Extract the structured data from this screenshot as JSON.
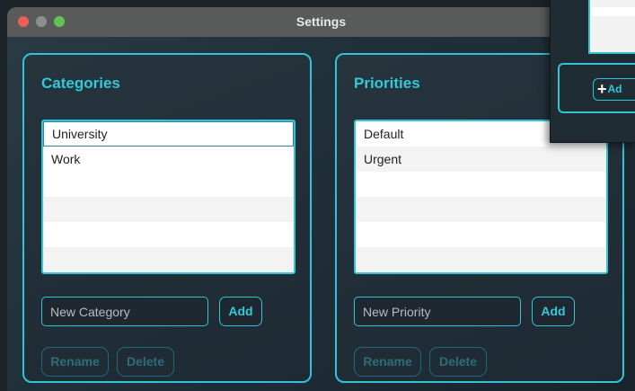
{
  "window": {
    "title": "Settings"
  },
  "categories": {
    "title": "Categories",
    "items": [
      "University",
      "Work"
    ],
    "input_placeholder": "New Category",
    "add_label": "Add",
    "rename_label": "Rename",
    "delete_label": "Delete"
  },
  "priorities": {
    "title": "Priorities",
    "items": [
      "Default",
      "Urgent"
    ],
    "input_placeholder": "New Priority",
    "add_label": "Add",
    "rename_label": "Rename",
    "delete_label": "Delete"
  },
  "background_window": {
    "add_label": "Ad"
  },
  "colors": {
    "accent": "#2fc4d6",
    "title_text": "#33c9da",
    "titlebar": "#595b5a"
  }
}
